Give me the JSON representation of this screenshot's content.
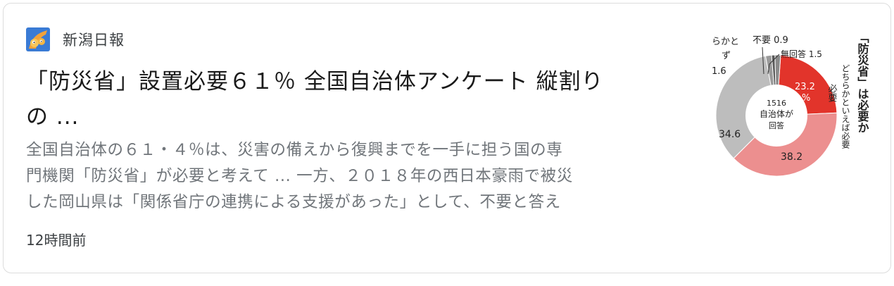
{
  "article": {
    "source": "新潟日報",
    "headline_line1": "「防災省」設置必要６１％ 全国自治体アンケート 縦割り",
    "headline_line2": "の ...",
    "snippet_line1": "全国自治体の６１・４％は、災害の備えから復興までを一手に担う国の専",
    "snippet_line2": "門機関「防災省」が必要と考えて ... 一方、２０１８年の西日本豪雨で被災",
    "snippet_line3": "した岡山県は「関係省庁の連携による支援があった」として、不要と答え",
    "time": "12時間前"
  },
  "thumbnail": {
    "top_label_1": "不要 0.9",
    "top_label_2": "無回答 1.5",
    "left_label_1": "らかと",
    "left_label_2": "ず",
    "left_label_3": "1.6",
    "center_1": "1516",
    "center_2": "自治体が",
    "center_3": "回答",
    "v1": "23.2",
    "v1_unit": "%",
    "v2": "38.2",
    "v3": "34.6",
    "vertical_title": "「防災省」は必要か",
    "vertical_label_1": "必要",
    "vertical_label_2": "どちらかといえば必要",
    "colors": {
      "needed": "#e2342b",
      "somewhat_needed": "#ec8f8f",
      "somewhat_not": "#bdbdbd",
      "not_needed": "#5a5a5a",
      "no_answer": "#8a8a8a"
    }
  },
  "chart_data": {
    "type": "pie",
    "title": "「防災省」は必要か",
    "center_label": "1516 自治体が回答",
    "slices": [
      {
        "label": "必要",
        "value": 23.2
      },
      {
        "label": "どちらかといえば必要",
        "value": 38.2
      },
      {
        "label": "",
        "value": 34.6
      },
      {
        "label": "",
        "value": 1.6
      },
      {
        "label": "不要",
        "value": 0.9
      },
      {
        "label": "無回答",
        "value": 1.5
      }
    ]
  }
}
